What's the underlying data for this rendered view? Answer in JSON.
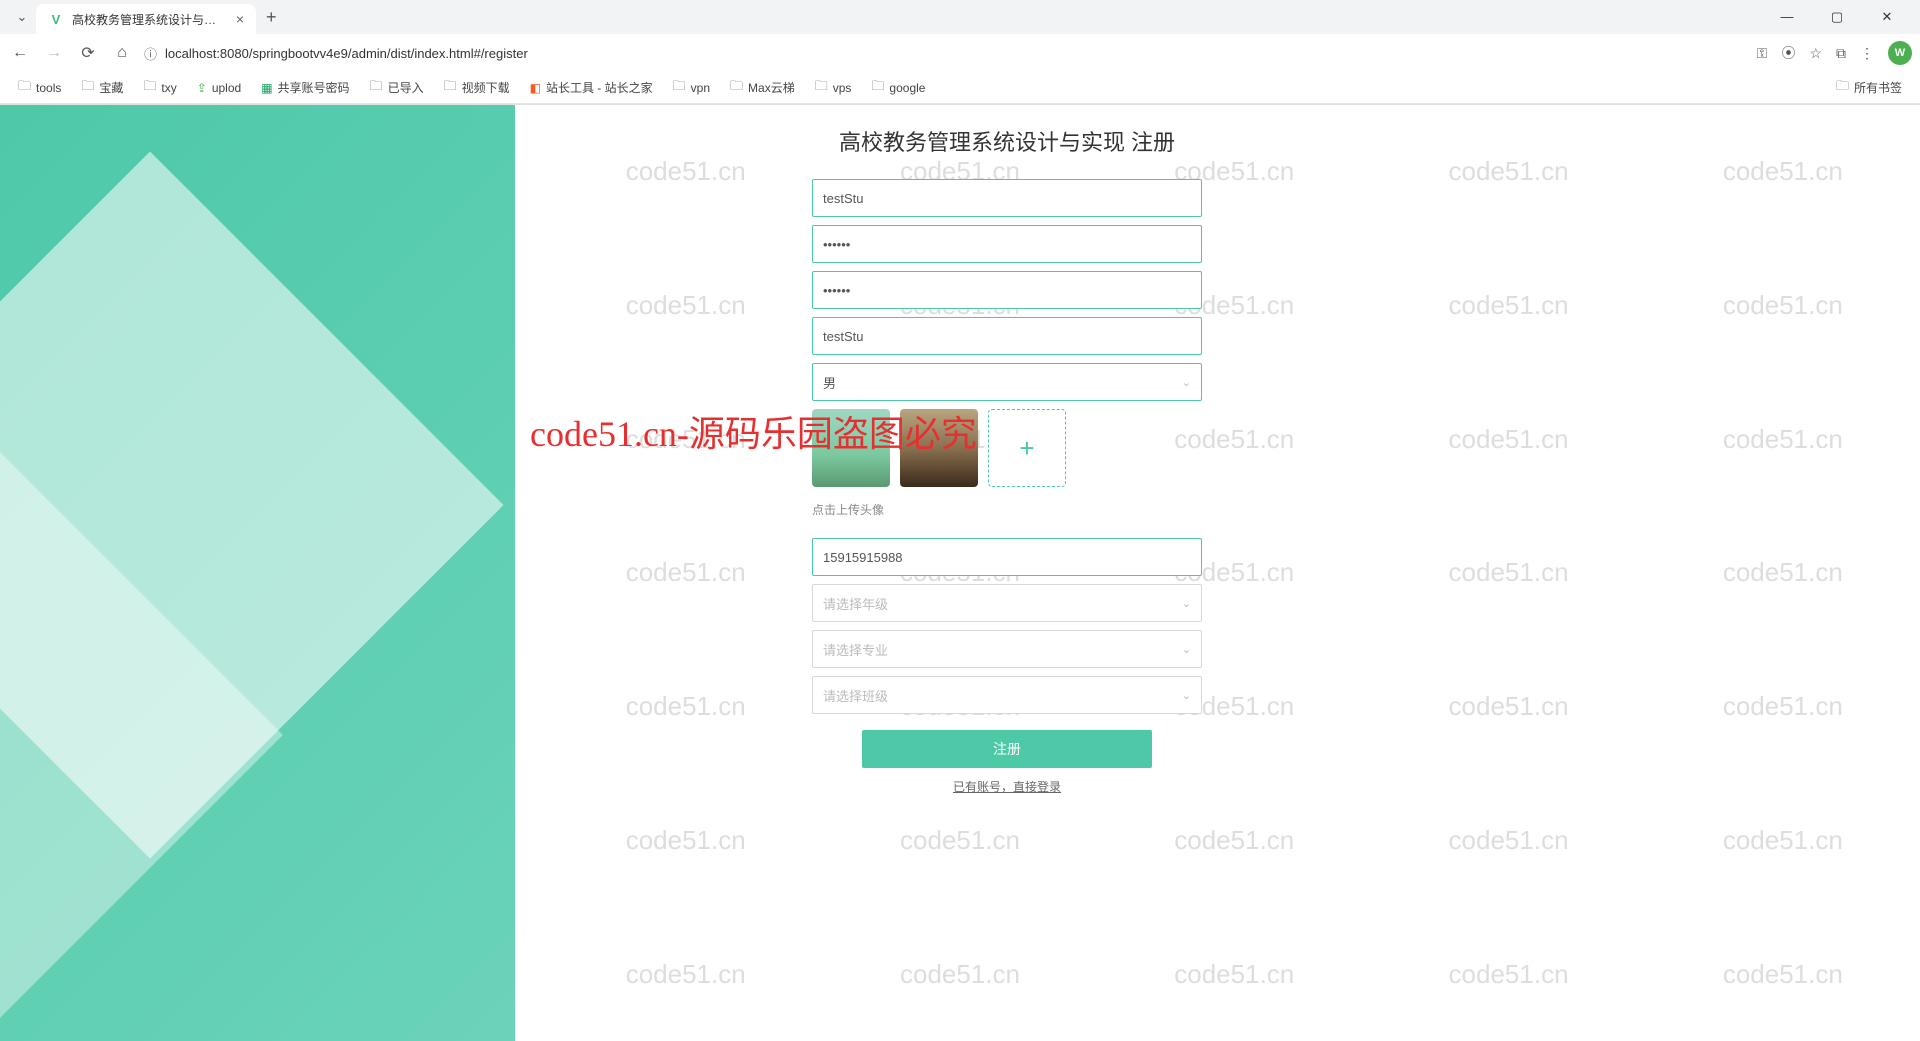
{
  "browser": {
    "tab_title": "高校教务管理系统设计与实现",
    "url": "localhost:8080/springbootvv4e9/admin/dist/index.html#/register",
    "profile_letter": "W"
  },
  "bookmarks": {
    "items": [
      {
        "label": "tools",
        "icon": "folder"
      },
      {
        "label": "宝藏",
        "icon": "folder"
      },
      {
        "label": "txy",
        "icon": "folder"
      },
      {
        "label": "uplod",
        "icon": "up"
      },
      {
        "label": "共享账号密码",
        "icon": "doc"
      },
      {
        "label": "已导入",
        "icon": "folder"
      },
      {
        "label": "视频下载",
        "icon": "folder"
      },
      {
        "label": "站长工具 - 站长之家",
        "icon": "tool"
      },
      {
        "label": "vpn",
        "icon": "folder"
      },
      {
        "label": "Max云梯",
        "icon": "folder"
      },
      {
        "label": "vps",
        "icon": "folder"
      },
      {
        "label": "google",
        "icon": "folder"
      }
    ],
    "right_label": "所有书签"
  },
  "watermark_text": "code51.cn",
  "overlay_text": "code51.cn-源码乐园盗图必究",
  "form": {
    "title": "高校教务管理系统设计与实现 注册",
    "username_value": "testStu",
    "password_value": "••••••",
    "confirm_value": "••••••",
    "realname_value": "testStu",
    "gender_value": "男",
    "upload_hint": "点击上传头像",
    "phone_value": "15915915988",
    "grade_placeholder": "请选择年级",
    "dept_placeholder": "请选择专业",
    "class_placeholder": "请选择班级",
    "submit_label": "注册",
    "login_link_label": "已有账号，直接登录"
  }
}
